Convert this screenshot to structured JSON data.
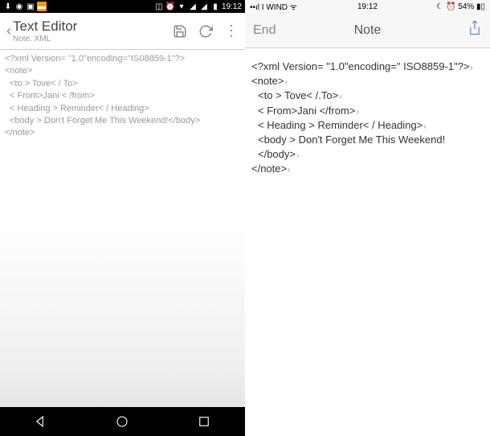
{
  "android": {
    "statusbar": {
      "time": "19:12"
    },
    "appbar": {
      "title": "Text Editor",
      "subtitle": "Note. XML"
    },
    "lines": [
      "<?xml Version= \"1.0\"encoding=\"IS08859-1\"?>",
      "<note>",
      "<to > Tove< / To>",
      "< From>Jani < /from>",
      "< Heading > Reminder< / Heading>",
      "<body > Don't Forget Me This Weekend!</body>",
      "</note>"
    ]
  },
  "ios": {
    "statusbar": {
      "carrier": "I WIND",
      "time": "19:12",
      "battery": "54%"
    },
    "navbar": {
      "back": "End",
      "title": "Note"
    },
    "lines": [
      "<?xml Version= \"1.0\"encoding=\" ISO8859-1\"?>",
      "<note>",
      "<to > Tove< /.To>",
      "< From>Jani </from>",
      "< Heading > Reminder< / Heading>",
      "<body > Don't Forget Me This Weekend!</body>",
      "</note>"
    ]
  }
}
